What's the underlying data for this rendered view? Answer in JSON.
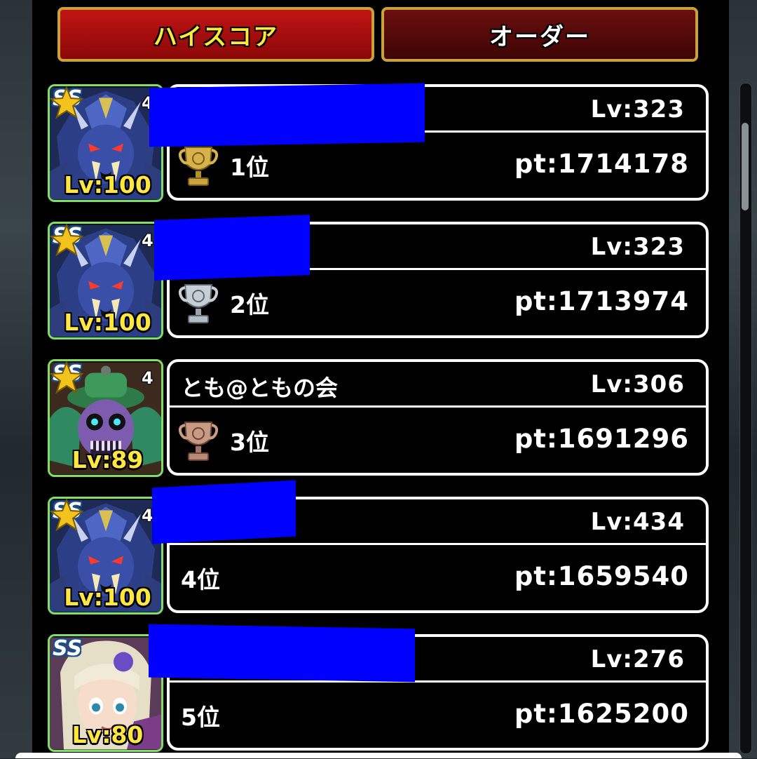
{
  "tabs": {
    "highscore": "ハイスコア",
    "order": "オーダー"
  },
  "entries": [
    {
      "name": "",
      "player_level": "Lv:323",
      "rank": "1位",
      "points": "pt:1714178",
      "monster_level": "Lv:100",
      "monster_rank": "SS",
      "stars": "4",
      "trophy": "gold-trophy-icon",
      "monster": "blue-demon-lord"
    },
    {
      "name": "",
      "player_level": "Lv:323",
      "rank": "2位",
      "points": "pt:1713974",
      "monster_level": "Lv:100",
      "monster_rank": "SS",
      "stars": "4",
      "trophy": "silver-trophy-icon",
      "monster": "blue-demon-lord"
    },
    {
      "name": "とも@ともの会",
      "player_level": "Lv:306",
      "rank": "3位",
      "points": "pt:1691296",
      "monster_level": "Lv:89",
      "monster_rank": "SS",
      "stars": "4",
      "trophy": "bronze-trophy-icon",
      "monster": "green-skull-mage"
    },
    {
      "name": "",
      "player_level": "Lv:434",
      "rank": "4位",
      "points": "pt:1659540",
      "monster_level": "Lv:100",
      "monster_rank": "SS",
      "stars": "4",
      "trophy": "",
      "monster": "blue-demon-lord"
    },
    {
      "name": "",
      "player_level": "Lv:276",
      "rank": "5位",
      "points": "pt:1625200",
      "monster_level": "Lv:80",
      "monster_rank": "SS",
      "stars": "",
      "trophy": "",
      "monster": "white-haired-heroine"
    }
  ],
  "colors": {
    "redaction": "#0000ff",
    "active_tab": "#c21414",
    "inactive_tab": "#6b0e0e",
    "tab_border": "#c9a13b",
    "monster_level": "#ffe640",
    "avatar_border": "#7fe064"
  }
}
